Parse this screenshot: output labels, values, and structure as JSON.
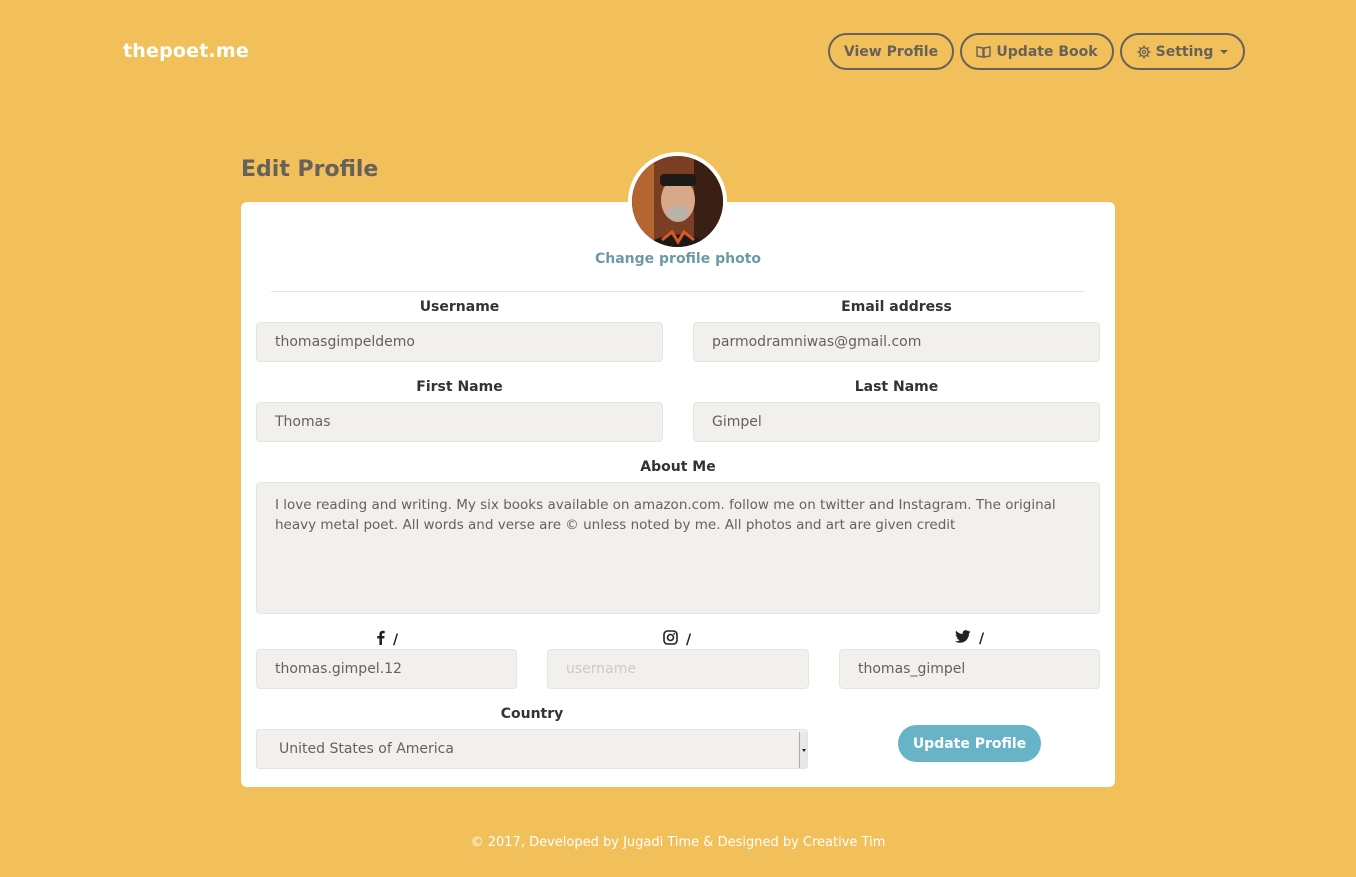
{
  "brand": "thepoet.me",
  "nav": {
    "view_profile": "View Profile",
    "update_book": "Update Book",
    "setting": "Setting"
  },
  "page_title": "Edit Profile",
  "profile": {
    "change_photo": "Change profile photo"
  },
  "form": {
    "username": {
      "label": "Username",
      "value": "thomasgimpeldemo"
    },
    "email": {
      "label": "Email address",
      "value": "parmodramniwas@gmail.com"
    },
    "first_name": {
      "label": "First Name",
      "value": "Thomas"
    },
    "last_name": {
      "label": "Last Name",
      "value": "Gimpel"
    },
    "about": {
      "label": "About Me",
      "value": "I love reading and writing. My six books available on amazon.com. follow me on twitter and Instagram. The original heavy metal poet. All words and verse are © unless noted by me. All photos and art are given credit"
    },
    "facebook": {
      "sep": "/",
      "value": "thomas.gimpel.12"
    },
    "instagram": {
      "sep": "/",
      "value": "",
      "placeholder": "username"
    },
    "twitter": {
      "sep": "/",
      "value": "thomas_gimpel"
    },
    "country": {
      "label": "Country",
      "value": "United States of America"
    },
    "submit": "Update Profile"
  },
  "footer": "© 2017, Developed by Jugadi Time & Designed by Creative Tim",
  "colors": {
    "background": "#f2c05a",
    "accent": "#68b3c8",
    "nav_text": "#66615b"
  }
}
